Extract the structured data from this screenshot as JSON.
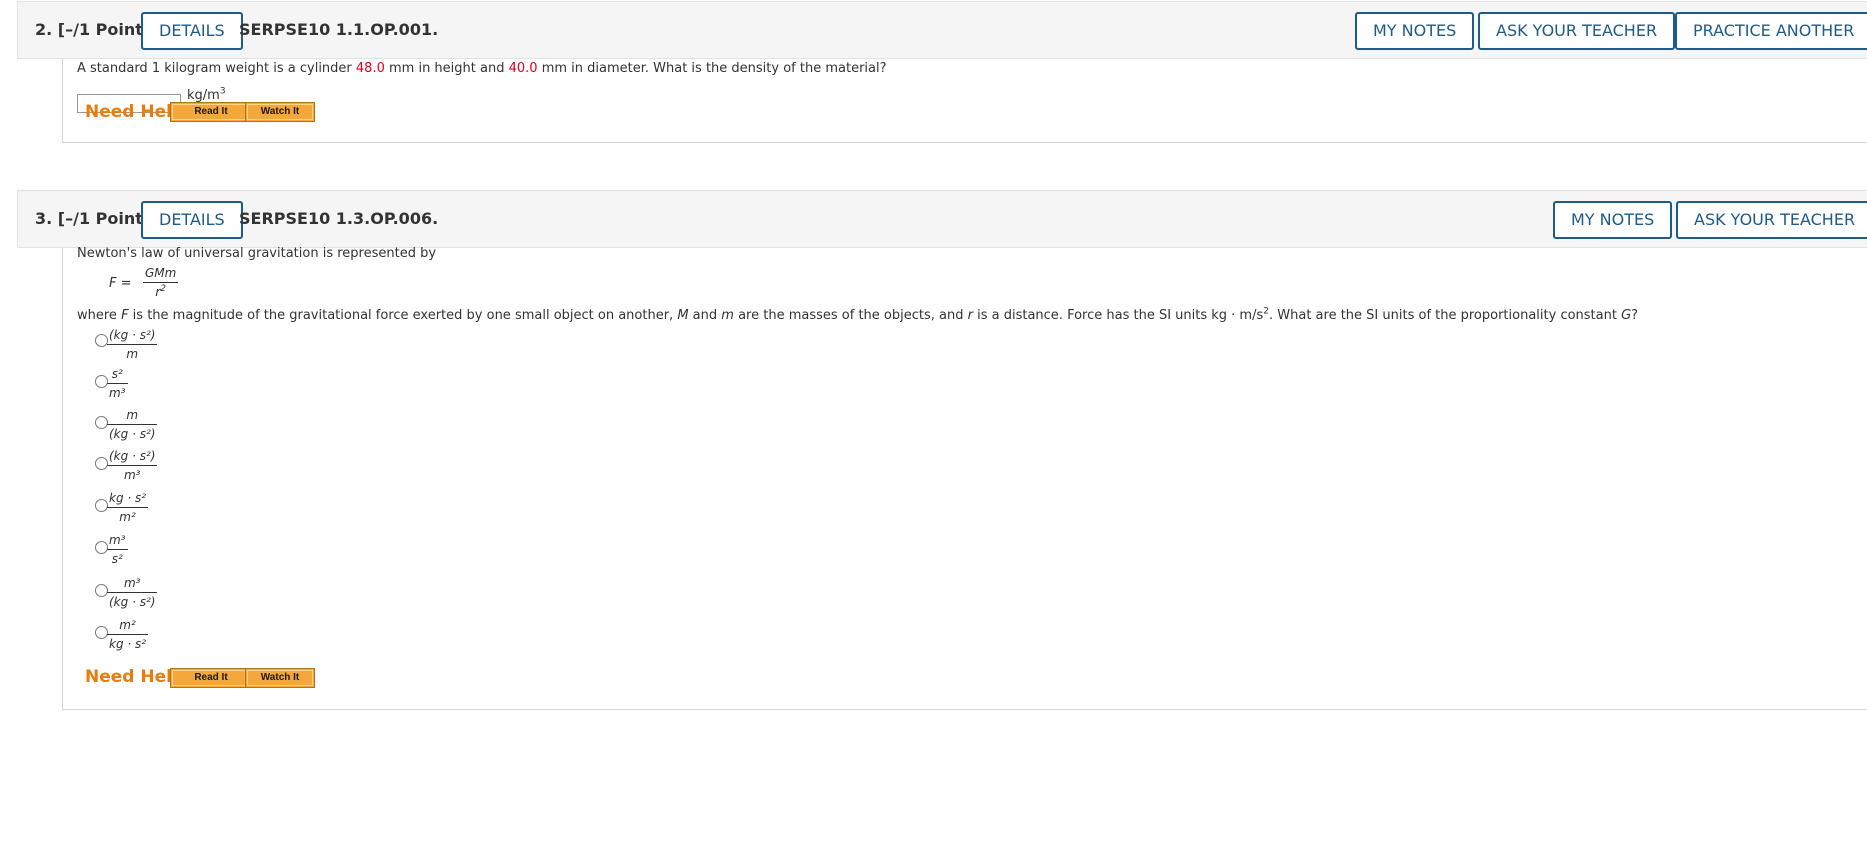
{
  "questions": [
    {
      "number_label": "2.",
      "points_label": "[–/1 Points]",
      "details_label": "DETAILS",
      "code": "SERPSE10 1.1.OP.001.",
      "header_buttons": [
        "MY NOTES",
        "ASK YOUR TEACHER",
        "PRACTICE ANOTHER"
      ],
      "prompt_part1": "A standard 1 kilogram weight is a cylinder ",
      "value_height": "48.0",
      "prompt_part2": " mm in height and ",
      "value_diameter": "40.0",
      "prompt_part3": " mm in diameter. What is the density of the material?",
      "answer_value": "",
      "unit_base": "kg/m",
      "unit_exp": "3",
      "need_help": "Need Help?",
      "help_buttons": [
        "Read It",
        "Watch It"
      ]
    },
    {
      "number_label": "3.",
      "points_label": "[–/1 Points]",
      "details_label": "DETAILS",
      "code": "SERPSE10 1.3.OP.006.",
      "header_buttons": [
        "MY NOTES",
        "ASK YOUR TEACHER"
      ],
      "intro": "Newton's law of universal gravitation is represented by",
      "formula": {
        "lhs": "F =",
        "numerator": "GMm",
        "denominator_base": "r",
        "denominator_exp": "2"
      },
      "where_part1": "where ",
      "where_F": "F",
      "where_part2": " is the magnitude of the gravitational force exerted by one small object on another, ",
      "where_M": "M",
      "where_part3": " and ",
      "where_m": "m",
      "where_part4": " are the masses of the objects, and ",
      "where_r": "r",
      "where_part5": " is a distance. Force has the SI units kg · m/s",
      "where_exp": "2",
      "where_part6": ". What are the SI units of the proportionality constant ",
      "where_G": "G",
      "where_part7": "?",
      "options": [
        {
          "num": "(kg · s²)",
          "den": "m"
        },
        {
          "num": "s²",
          "den": "m³"
        },
        {
          "num": "m",
          "den": "(kg · s²)"
        },
        {
          "num": "(kg · s²)",
          "den": "m³"
        },
        {
          "num": "kg · s²",
          "den": "m²"
        },
        {
          "num": "m³",
          "den": "s²"
        },
        {
          "num": "m³",
          "den": "(kg · s²)"
        },
        {
          "num": "m²",
          "den": "kg · s²"
        }
      ],
      "need_help": "Need Help?",
      "help_buttons": [
        "Read It",
        "Watch It"
      ]
    }
  ],
  "colors": {
    "accent": "#1e5a8a",
    "highlight_value": "#e0001b",
    "need_help": "#e87d0d",
    "help_button": "#f4a73a"
  }
}
